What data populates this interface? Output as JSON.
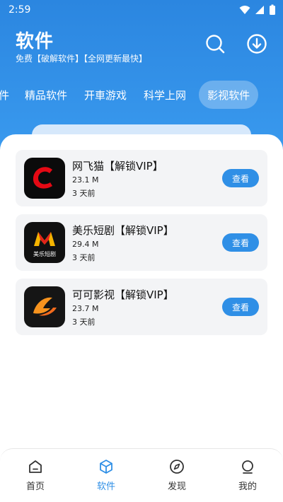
{
  "status": {
    "time": "2:59"
  },
  "header": {
    "title": "软件",
    "subtitle": "免费【破解软件】【全网更新最快】"
  },
  "tabs": [
    {
      "label": "件"
    },
    {
      "label": "精品软件"
    },
    {
      "label": "开車游戏"
    },
    {
      "label": "科学上网"
    },
    {
      "label": "影视软件",
      "active": true
    }
  ],
  "apps": [
    {
      "name": "网飞猫【解锁VIP】",
      "size": "23.1 M",
      "time": "3 天前",
      "button": "查看",
      "icon_text": ""
    },
    {
      "name": "美乐短剧【解锁VIP】",
      "size": "29.4 M",
      "time": "3 天前",
      "button": "查看",
      "icon_text": "美乐短剧"
    },
    {
      "name": "可可影视【解锁VIP】",
      "size": "23.7 M",
      "time": "3 天前",
      "button": "查看",
      "icon_text": ""
    }
  ],
  "nav": [
    {
      "label": "首页",
      "icon": "home-icon"
    },
    {
      "label": "软件",
      "icon": "cube-icon",
      "active": true
    },
    {
      "label": "发现",
      "icon": "compass-icon"
    },
    {
      "label": "我的",
      "icon": "profile-icon"
    }
  ],
  "colors": {
    "accent": "#2f8fe6",
    "card_bg": "#f3f4f6"
  }
}
